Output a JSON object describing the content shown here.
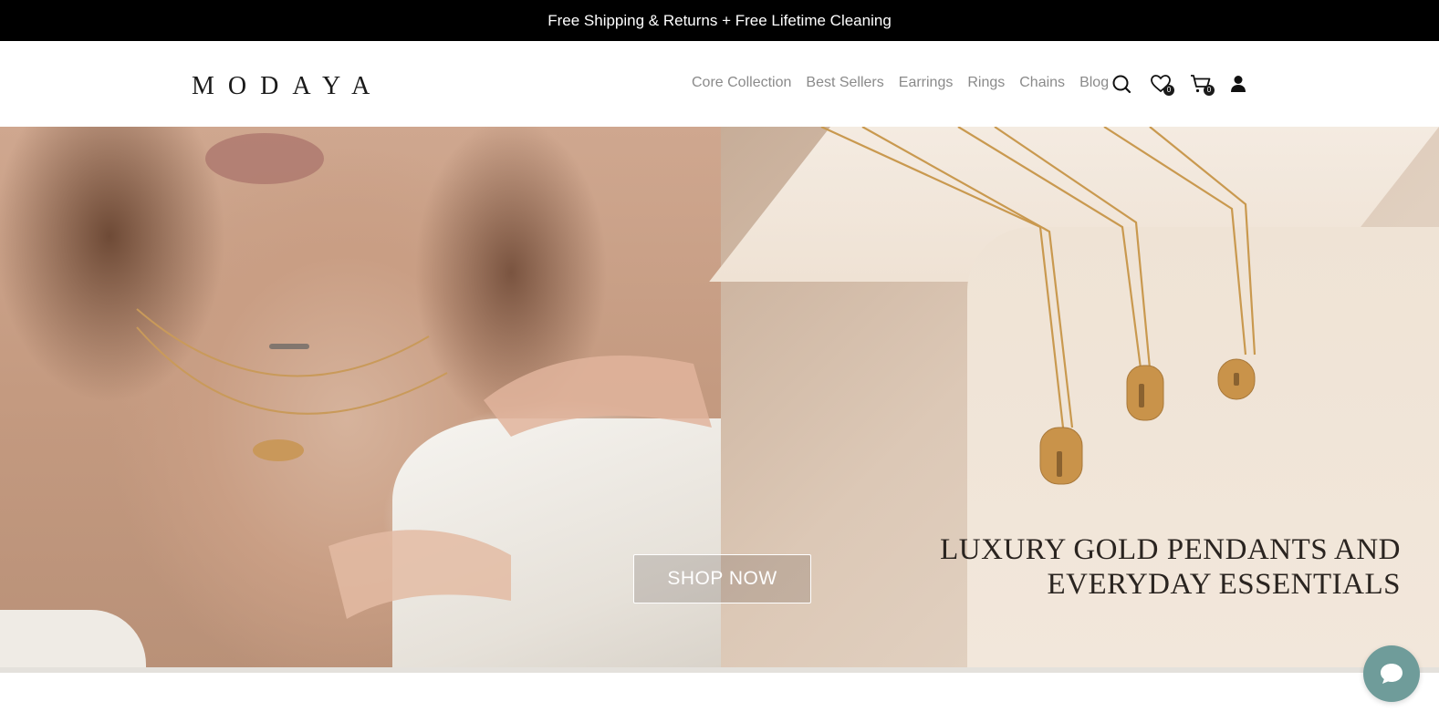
{
  "announcement": {
    "text": "Free Shipping & Returns + Free Lifetime Cleaning"
  },
  "header": {
    "logo": "MODAYA",
    "nav": [
      {
        "label": "Core Collection"
      },
      {
        "label": "Best Sellers"
      },
      {
        "label": "Earrings"
      },
      {
        "label": "Rings"
      },
      {
        "label": "Chains"
      },
      {
        "label": "Blog"
      }
    ],
    "icons": {
      "search": "search-icon",
      "wishlist": "heart-icon",
      "cart": "cart-icon",
      "account": "user-icon"
    },
    "wishlist_count": "0",
    "cart_count": "0"
  },
  "hero": {
    "cta_label": "SHOP NOW",
    "headline_line1": "LUXURY GOLD PENDANTS AND",
    "headline_line2": "EVERYDAY ESSENTIALS"
  },
  "chat": {
    "icon": "chat-bubble-icon",
    "color": "#6f9c9a"
  },
  "colors": {
    "announcement_bg": "#000000",
    "nav_text": "#8a8a8a",
    "headline_text": "#2a2420"
  }
}
